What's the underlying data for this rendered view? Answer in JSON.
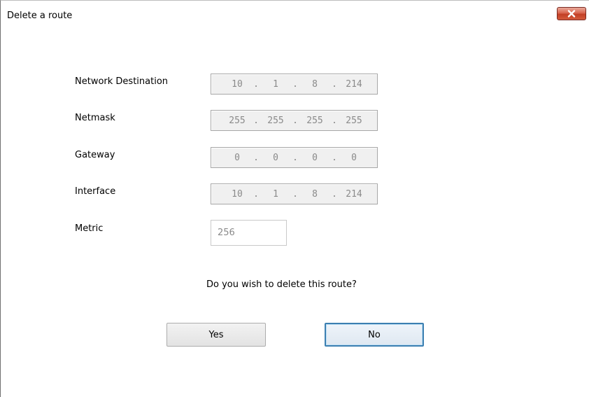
{
  "window": {
    "title": "Delete a route",
    "close_icon": "close-icon"
  },
  "fields": {
    "destination": {
      "label": "Network Destination",
      "octets": [
        "10",
        "1",
        "8",
        "214"
      ]
    },
    "netmask": {
      "label": "Netmask",
      "octets": [
        "255",
        "255",
        "255",
        "255"
      ]
    },
    "gateway": {
      "label": "Gateway",
      "octets": [
        "0",
        "0",
        "0",
        "0"
      ]
    },
    "interface": {
      "label": "Interface",
      "octets": [
        "10",
        "1",
        "8",
        "214"
      ]
    },
    "metric": {
      "label": "Metric",
      "value": "256"
    }
  },
  "separator": ".",
  "prompt": "Do you wish to delete this route?",
  "buttons": {
    "yes": "Yes",
    "no": "No"
  },
  "colors": {
    "close_button": "#c94a30",
    "default_button_border": "#3c7fb1",
    "disabled_text": "#8a8a8a"
  }
}
